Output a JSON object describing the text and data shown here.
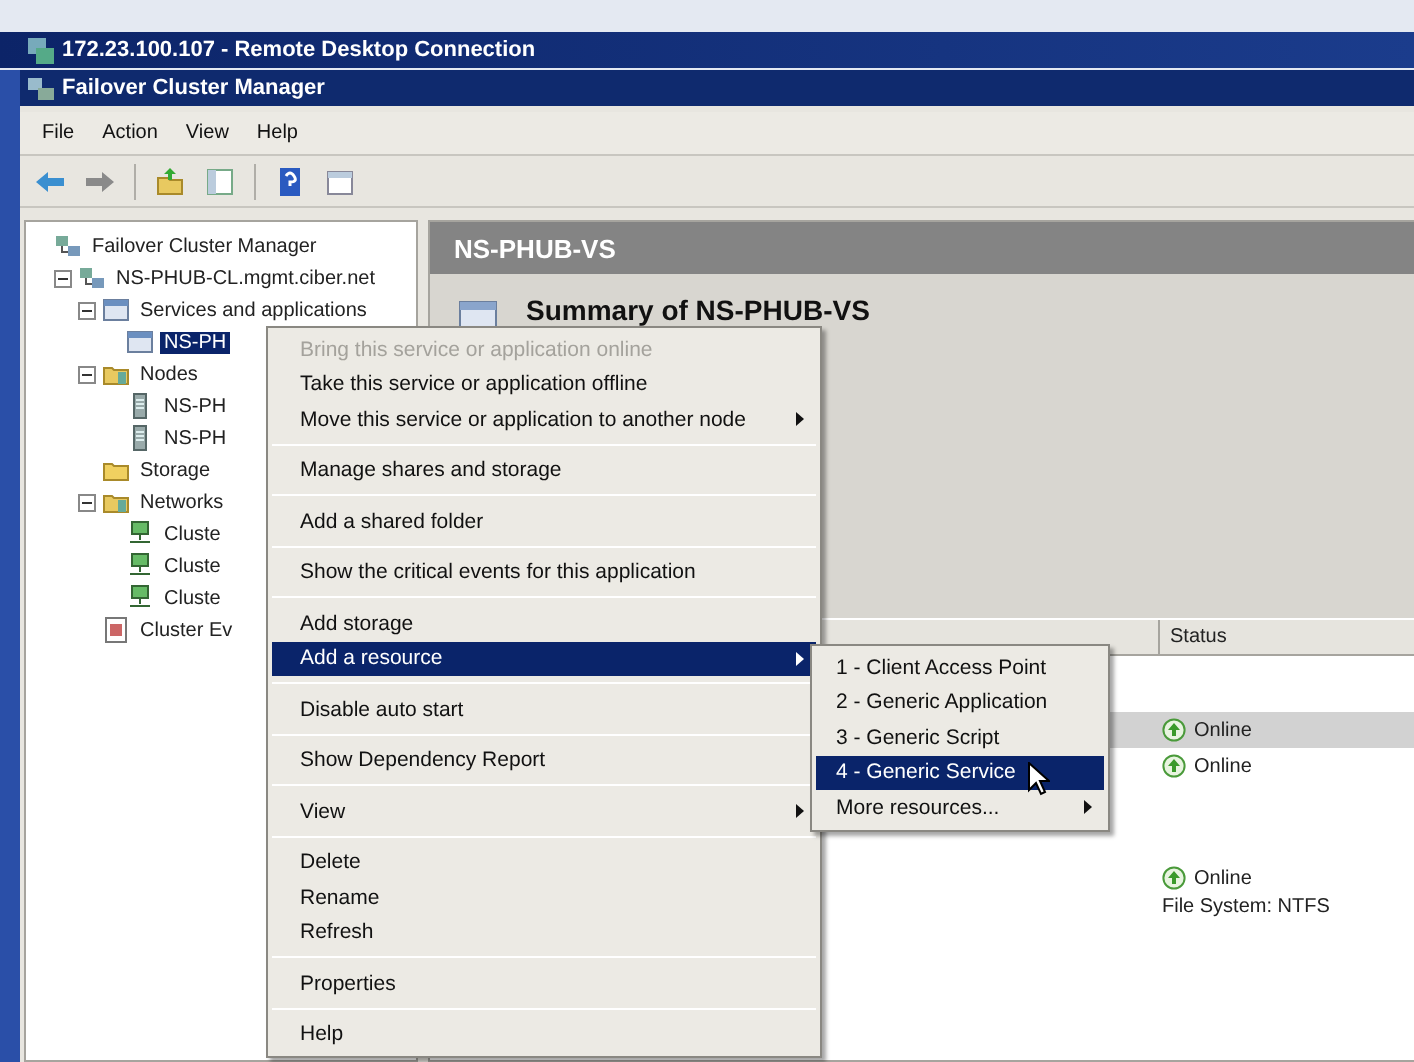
{
  "remote_window": {
    "title": "172.23.100.107 - Remote Desktop Connection"
  },
  "window": {
    "title": "Failover Cluster Manager"
  },
  "menu_bar": [
    "File",
    "Action",
    "View",
    "Help"
  ],
  "toolbar": [
    {
      "kind": "back"
    },
    {
      "kind": "forward"
    },
    {
      "kind": "separator"
    },
    {
      "kind": "up"
    },
    {
      "kind": "tree"
    },
    {
      "kind": "separator"
    },
    {
      "kind": "help"
    },
    {
      "kind": "pane"
    }
  ],
  "tree": [
    {
      "label": "Failover Cluster Manager",
      "kind": "cluster",
      "selected": false,
      "children": [
        {
          "label": "NS-PHUB-CL.mgmt.ciber.net",
          "kind": "cluster",
          "expanded": true,
          "selected": false,
          "children": [
            {
              "label": "Services and applications",
              "kind": "services",
              "expanded": true,
              "selected": false,
              "children": [
                {
                  "label": "NS-PH",
                  "kind": "services",
                  "selected": true
                }
              ]
            },
            {
              "label": "Nodes",
              "kind": "nodes",
              "expanded": true,
              "selected": false,
              "children": [
                {
                  "label": "NS-PH",
                  "kind": "server",
                  "selected": false
                },
                {
                  "label": "NS-PH",
                  "kind": "server",
                  "selected": false
                }
              ]
            },
            {
              "label": "Storage",
              "kind": "storage",
              "selected": false
            },
            {
              "label": "Networks",
              "kind": "nodes",
              "expanded": true,
              "selected": false,
              "children": [
                {
                  "label": "Cluste",
                  "kind": "network",
                  "selected": false
                },
                {
                  "label": "Cluste",
                  "kind": "network",
                  "selected": false
                },
                {
                  "label": "Cluste",
                  "kind": "network",
                  "selected": false
                }
              ]
            },
            {
              "label": "Cluster Ev",
              "kind": "events",
              "selected": false
            }
          ]
        }
      ]
    }
  ],
  "details": {
    "header": "NS-PHUB-VS",
    "summary_title": "Summary of NS-PHUB-VS",
    "table": {
      "columns": [
        "Status"
      ],
      "groups": [
        {
          "rows": [
            {
              "status": "Online",
              "selected": true
            },
            {
              "status": "Online",
              "selected": false
            }
          ]
        },
        {
          "rows": [
            {
              "status": "Online",
              "detail": "File System: NTFS",
              "selected": false
            }
          ]
        }
      ]
    }
  },
  "context_menu": [
    [
      {
        "label": "Bring this service or application online",
        "disabled": true,
        "submenu": false,
        "selected": false
      },
      {
        "label": "Take this service or application offline",
        "disabled": false,
        "submenu": false,
        "selected": false
      },
      {
        "label": "Move this service or application to another node",
        "disabled": false,
        "submenu": true,
        "selected": false
      }
    ],
    [
      {
        "label": "Manage shares and storage",
        "disabled": false,
        "submenu": false,
        "selected": false
      }
    ],
    [
      {
        "label": "Add a shared folder",
        "disabled": false,
        "submenu": false,
        "selected": false
      }
    ],
    [
      {
        "label": "Show the critical events for this application",
        "disabled": false,
        "submenu": false,
        "selected": false
      }
    ],
    [
      {
        "label": "Add storage",
        "disabled": false,
        "submenu": false,
        "selected": false
      },
      {
        "label": "Add a resource",
        "disabled": false,
        "submenu": true,
        "selected": true
      }
    ],
    [
      {
        "label": "Disable auto start",
        "disabled": false,
        "submenu": false,
        "selected": false
      }
    ],
    [
      {
        "label": "Show Dependency Report",
        "disabled": false,
        "submenu": false,
        "selected": false
      }
    ],
    [
      {
        "label": "View",
        "disabled": false,
        "submenu": true,
        "selected": false
      }
    ],
    [
      {
        "label": "Delete",
        "disabled": false,
        "submenu": false,
        "selected": false
      },
      {
        "label": "Rename",
        "disabled": false,
        "submenu": false,
        "selected": false
      },
      {
        "label": "Refresh",
        "disabled": false,
        "submenu": false,
        "selected": false
      }
    ],
    [
      {
        "label": "Properties",
        "disabled": false,
        "submenu": false,
        "selected": false
      }
    ],
    [
      {
        "label": "Help",
        "disabled": false,
        "submenu": false,
        "selected": false
      }
    ]
  ],
  "submenu": [
    {
      "label": "1 - Client Access Point",
      "submenu": false,
      "selected": false
    },
    {
      "label": "2 - Generic Application",
      "submenu": false,
      "selected": false
    },
    {
      "label": "3 - Generic Script",
      "submenu": false,
      "selected": false
    },
    {
      "label": "4 - Generic Service",
      "submenu": false,
      "selected": true
    },
    {
      "label": "More resources...",
      "submenu": true,
      "selected": false
    }
  ]
}
